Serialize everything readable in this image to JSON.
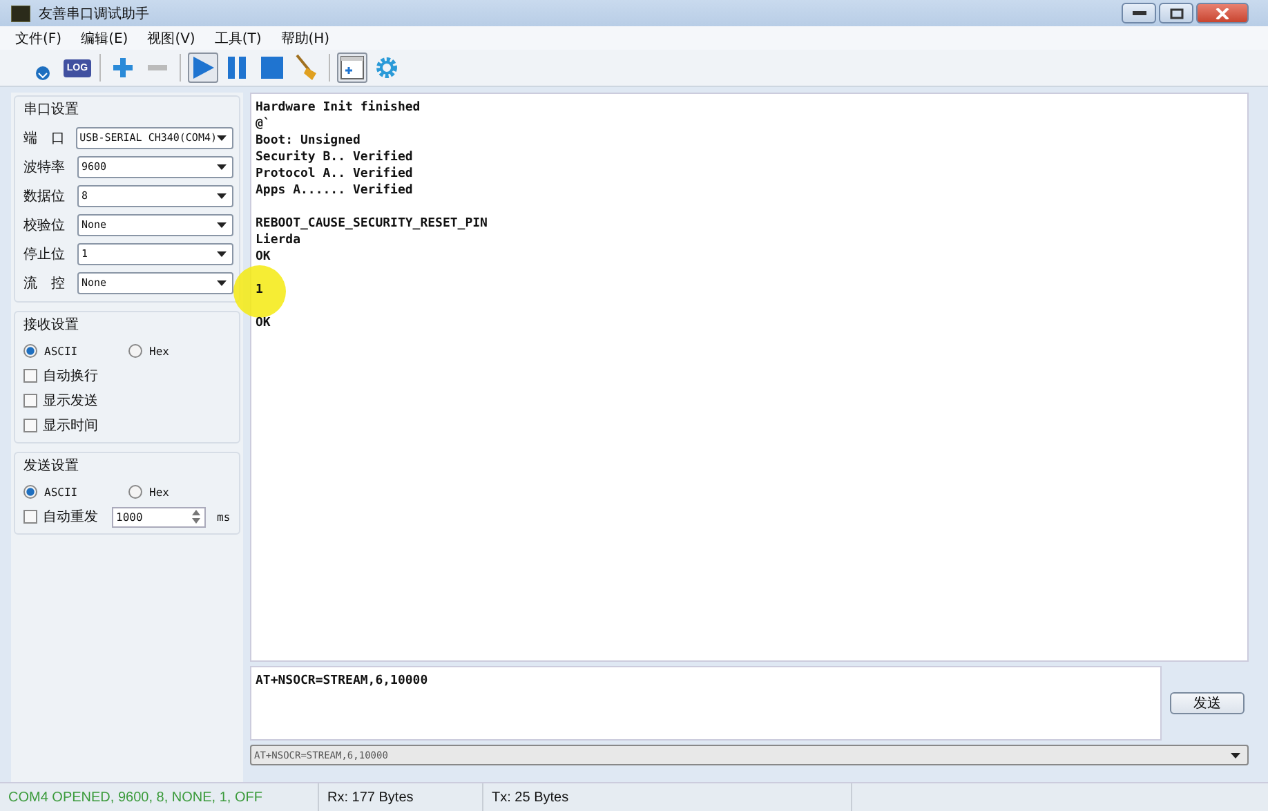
{
  "window": {
    "title": "友善串口调试助手"
  },
  "menu": [
    "文件(F)",
    "编辑(E)",
    "视图(V)",
    "工具(T)",
    "帮助(H)"
  ],
  "toolbar": [
    {
      "kind": "save",
      "selected": false
    },
    {
      "kind": "log",
      "label": "LOG",
      "selected": false
    },
    {
      "kind": "sep"
    },
    {
      "kind": "plus",
      "selected": false
    },
    {
      "kind": "minus",
      "selected": false
    },
    {
      "kind": "sep"
    },
    {
      "kind": "play",
      "selected": true
    },
    {
      "kind": "pause",
      "selected": false
    },
    {
      "kind": "stop",
      "selected": false
    },
    {
      "kind": "broom",
      "selected": false
    },
    {
      "kind": "sep"
    },
    {
      "kind": "window",
      "selected": true
    },
    {
      "kind": "gear",
      "selected": false
    }
  ],
  "serial_settings": {
    "title": "串口设置",
    "fields": [
      {
        "label": "端　口",
        "value": "USB-SERIAL CH340(COM4)"
      },
      {
        "label": "波特率",
        "value": "9600"
      },
      {
        "label": "数据位",
        "value": "8"
      },
      {
        "label": "校验位",
        "value": "None"
      },
      {
        "label": "停止位",
        "value": "1"
      },
      {
        "label": "流　控",
        "value": "None"
      }
    ]
  },
  "receive_settings": {
    "title": "接收设置",
    "modes": [
      {
        "label": "ASCII",
        "selected": true
      },
      {
        "label": "Hex",
        "selected": false
      }
    ],
    "options": [
      {
        "label": "自动换行",
        "checked": false
      },
      {
        "label": "显示发送",
        "checked": false
      },
      {
        "label": "显示时间",
        "checked": false
      }
    ]
  },
  "send_settings": {
    "title": "发送设置",
    "modes": [
      {
        "label": "ASCII",
        "selected": true
      },
      {
        "label": "Hex",
        "selected": false
      }
    ],
    "auto_resend": {
      "label": "自动重发",
      "checked": false,
      "interval": "1000",
      "unit": "ms"
    }
  },
  "receive_log": [
    [
      "Hardware Init finished",
      "@`",
      "Boot: Unsigned",
      "Security B.. Verified",
      "Protocol A.. Verified",
      "Apps A...... Verified"
    ],
    [
      "REBOOT_CAUSE_SECURITY_RESET_PIN",
      "Lierda",
      "OK"
    ],
    [
      "1"
    ],
    [
      "OK"
    ]
  ],
  "send_input": {
    "value": "AT+NSOCR=STREAM,6,10000"
  },
  "send_button": "发送",
  "history": {
    "value": "AT+NSOCR=STREAM,6,10000"
  },
  "status_bar": [
    "COM4 OPENED, 9600, 8, NONE, 1, OFF",
    "Rx: 177 Bytes",
    "Tx: 25 Bytes"
  ]
}
